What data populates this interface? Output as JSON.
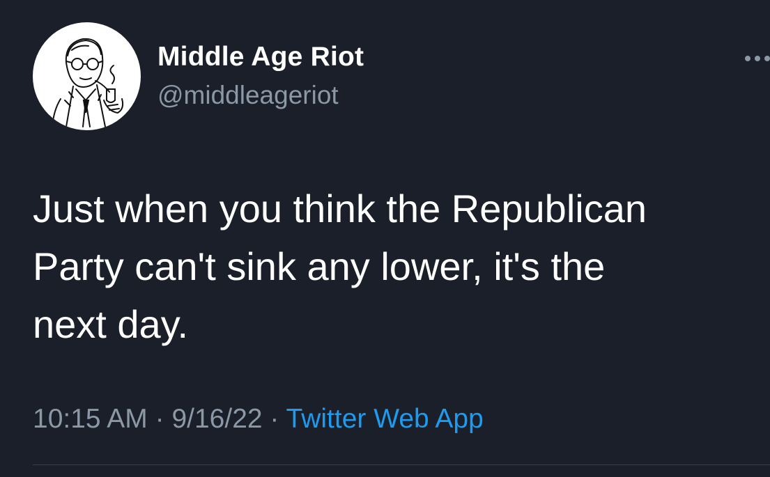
{
  "tweet": {
    "display_name": "Middle Age Riot",
    "handle": "@middleageriot",
    "text": "Just when you think the Republican\nParty can't sink any lower, it's the\nnext day.",
    "time": "10:15 AM",
    "separator": " · ",
    "date": "9/16/22",
    "source": "Twitter Web App"
  },
  "icons": {
    "avatar": "man-with-pipe-illustration",
    "more": "more-dots-icon"
  },
  "colors": {
    "background": "#1a1f29",
    "text_primary": "#ffffff",
    "text_secondary": "#8b98a5",
    "link": "#1d9bf0"
  }
}
